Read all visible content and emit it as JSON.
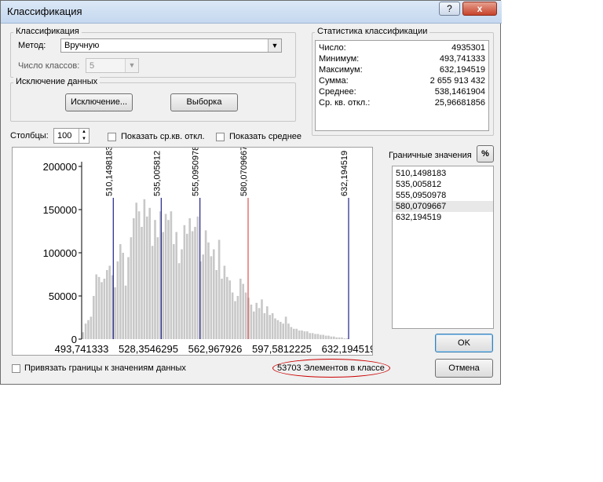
{
  "window": {
    "title": "Классификация"
  },
  "titlebar_buttons": {
    "help": "?",
    "close": "x"
  },
  "classification": {
    "legend": "Классификация",
    "method_label": "Метод:",
    "method_value": "Вручную",
    "classes_label": "Число классов:",
    "classes_value": "5"
  },
  "exclusion": {
    "legend": "Исключение данных",
    "exclude_button": "Исключение...",
    "sample_button": "Выборка"
  },
  "statistics": {
    "legend": "Статистика классификации",
    "rows": [
      {
        "label": "Число:",
        "value": "4935301"
      },
      {
        "label": "Минимум:",
        "value": "493,741333"
      },
      {
        "label": "Максимум:",
        "value": "632,194519"
      },
      {
        "label": "Сумма:",
        "value": "2 655 913 432"
      },
      {
        "label": "Среднее:",
        "value": "538,1461904"
      },
      {
        "label": "Ср. кв. откл.:",
        "value": "25,96681856"
      }
    ]
  },
  "columns": {
    "label": "Столбцы:",
    "value": "100"
  },
  "show_stddev": {
    "label": "Показать ср.кв. откл."
  },
  "show_mean": {
    "label": "Показать среднее"
  },
  "break_values": {
    "title": "Граничные значения",
    "percent_button": "%",
    "items": [
      "510,1498183",
      "535,005812",
      "555,0950978",
      "580,0709667",
      "632,194519"
    ],
    "selected_index": 3
  },
  "buttons": {
    "ok": "OK",
    "cancel": "Отмена"
  },
  "snap_option": {
    "label": "Привязать границы к значениям данных"
  },
  "status": {
    "elements_in_class": "53703 Элементов в классе"
  },
  "colors": {
    "bars": "#c8c8c8",
    "break_line": "#20208a",
    "selected_break": "#e05050",
    "annotation": "#cc0000"
  },
  "chart_data": {
    "type": "bar",
    "xlim": [
      493.741333,
      632.194519
    ],
    "ylim": [
      0,
      200000
    ],
    "y_ticks": [
      "200000",
      "150000",
      "100000",
      "50000",
      "0"
    ],
    "y_tick_values": [
      200000,
      150000,
      100000,
      50000,
      0
    ],
    "x_ticks": [
      "493,741333",
      "528,3546295",
      "562,967926",
      "597,5812225",
      "632,194519"
    ],
    "x_tick_values": [
      493.741333,
      528.3546295,
      562.967926,
      597.5812225,
      632.194519
    ],
    "values": [
      8000,
      18000,
      22000,
      26000,
      50000,
      75000,
      72000,
      66000,
      70000,
      80000,
      85000,
      74000,
      60000,
      90000,
      110000,
      100000,
      62000,
      95000,
      118000,
      140000,
      158000,
      148000,
      130000,
      162000,
      142000,
      152000,
      108000,
      138000,
      118000,
      148000,
      124000,
      145000,
      138000,
      148000,
      110000,
      124000,
      88000,
      104000,
      132000,
      122000,
      140000,
      125000,
      130000,
      142000,
      90000,
      98000,
      126000,
      112000,
      96000,
      104000,
      80000,
      115000,
      70000,
      85000,
      72000,
      68000,
      54000,
      44000,
      50000,
      70000,
      64000,
      54000,
      48000,
      40000,
      32000,
      42000,
      36000,
      46000,
      30000,
      38000,
      28000,
      30000,
      24000,
      22000,
      20000,
      18000,
      26000,
      18000,
      14000,
      12000,
      12000,
      10000,
      10000,
      9000,
      9000,
      7000,
      7000,
      6000,
      6000,
      5000,
      5000,
      4000,
      4000,
      3000,
      3000,
      2000,
      2000,
      2000,
      1000,
      1000
    ],
    "break_lines": [
      {
        "label": "510,1498183",
        "value": 510.1498183
      },
      {
        "label": "535,005812",
        "value": 535.005812
      },
      {
        "label": "555,0950978",
        "value": 555.0950978
      },
      {
        "label": "580,0709667",
        "value": 580.0709667
      },
      {
        "label": "632,194519",
        "value": 632.194519
      }
    ]
  }
}
